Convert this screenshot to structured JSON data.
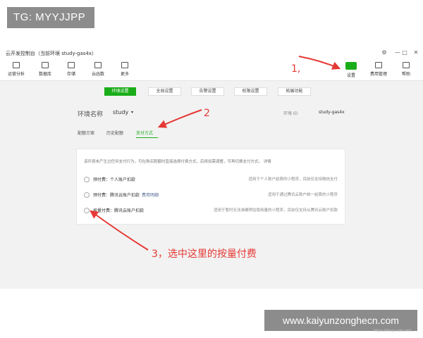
{
  "watermark_top": "TG: MYYJJPP",
  "watermark_bottom": "www.kaiyunzonghecn.com",
  "window": {
    "title": "云开发控制台（当前环境 study-gas4x）",
    "controls": [
      "⚙",
      "—",
      "□",
      "✕"
    ]
  },
  "toolbar": {
    "left": [
      {
        "label": "运营分析",
        "icon": "chart-icon"
      },
      {
        "label": "数据库",
        "icon": "database-icon"
      },
      {
        "label": "存储",
        "icon": "storage-icon"
      },
      {
        "label": "云函数",
        "icon": "cloud-function-icon"
      },
      {
        "label": "更多",
        "icon": "more-icon"
      }
    ],
    "right": [
      {
        "label": "设置",
        "icon": "gear-icon"
      },
      {
        "label": "费用管理",
        "icon": "billing-icon"
      },
      {
        "label": "帮助",
        "icon": "help-icon"
      }
    ]
  },
  "tabs": [
    "环境设置",
    "全局设置",
    "告警设置",
    "权限设置",
    "拓展功能"
  ],
  "env": {
    "label": "环境名称",
    "value": "study",
    "caret": "▾",
    "id_label": "环境 ID",
    "id_value": "study-gas4x"
  },
  "subtabs": [
    "配额方案",
    "历史配额",
    "支付方式"
  ],
  "panel": {
    "description": "该环境未产生过任何支付行为，可在购买配额时直接选择付费方式，后续如需调整，可再切换支付方式。 详情",
    "options": [
      {
        "label": "预付费：个人账户扣款",
        "link": "",
        "desc": "适用于个人账户结算的小程序，目前仅支持微信支付"
      },
      {
        "label": "预付费：腾讯云账户扣款",
        "link": "费用明细",
        "desc": "适用于通过腾讯云账户统一结算的小程序"
      },
      {
        "label": "按量付费：腾讯云账户扣款",
        "link": "",
        "desc": "适用于暂时无法准确预估使用量的小程序，目前仅支持从腾讯云账户扣款"
      }
    ]
  },
  "annotations": {
    "step1": "1,",
    "step2": "2",
    "step3": "3，选中这里的按量付费"
  },
  "faint_text": "https://blog.csdn.net/...",
  "colors": {
    "accent": "#1aad19",
    "annotation": "#e53935"
  }
}
